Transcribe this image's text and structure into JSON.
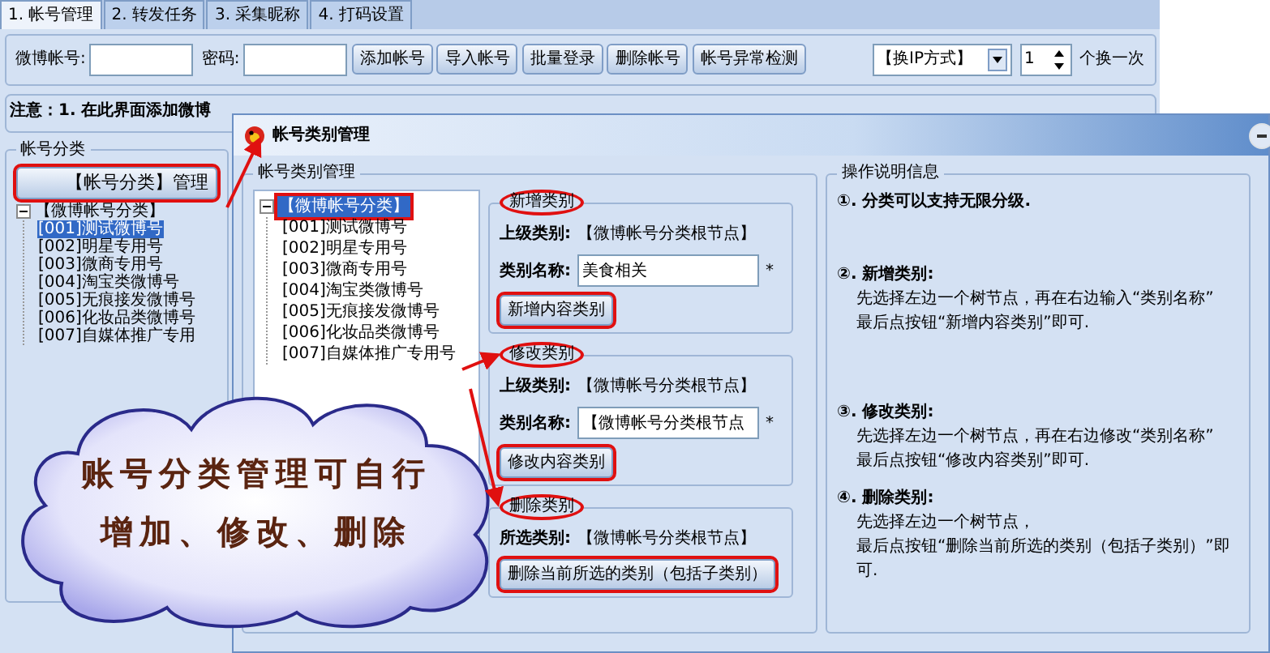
{
  "tabs": [
    {
      "label": "1. 帐号管理",
      "selected": true
    },
    {
      "label": "2. 转发任务",
      "selected": false
    },
    {
      "label": "3. 采集昵称",
      "selected": false
    },
    {
      "label": "4. 打码设置",
      "selected": false
    }
  ],
  "toolbar": {
    "account_label": "微博帐号:",
    "password_label": "密码:",
    "buttons": [
      {
        "label": "添加帐号"
      },
      {
        "label": "导入帐号"
      },
      {
        "label": "批量登录"
      },
      {
        "label": "删除帐号"
      },
      {
        "label": "帐号异常检测"
      }
    ],
    "ip_mode": {
      "value": "【换IP方式】"
    },
    "switch_count": {
      "value": "1"
    },
    "switch_suffix": "个换一次"
  },
  "notice": "注意：1. 在此界面添加微博",
  "category_panel": {
    "title": "帐号分类",
    "manage_button": {
      "label": "【帐号分类】管理",
      "highlighted": true
    },
    "tree": [
      {
        "label": "【微博帐号分类】",
        "selected": false,
        "highlighted": false,
        "expanded": true,
        "children": [
          {
            "label": "[001]测试微博号",
            "selected": true,
            "highlighted": false
          },
          {
            "label": "[002]明星专用号",
            "selected": false,
            "highlighted": false
          },
          {
            "label": "[003]微商专用号",
            "selected": false,
            "highlighted": false
          },
          {
            "label": "[004]淘宝类微博号",
            "selected": false,
            "highlighted": false
          },
          {
            "label": "[005]无痕接发微博号",
            "selected": false,
            "highlighted": false
          },
          {
            "label": "[006]化妆品类微博号",
            "selected": false,
            "highlighted": false
          },
          {
            "label": "[007]自媒体推广专用",
            "selected": false,
            "highlighted": false
          }
        ]
      }
    ]
  },
  "dialog": {
    "title": "帐号类别管理",
    "tree_group": {
      "title": "帐号类别管理",
      "tree": [
        {
          "label": "【微博帐号分类】",
          "selected": true,
          "highlighted": true,
          "expanded": true,
          "children": [
            {
              "label": "[001]测试微博号",
              "selected": false,
              "highlighted": false
            },
            {
              "label": "[002]明星专用号",
              "selected": false,
              "highlighted": false
            },
            {
              "label": "[003]微商专用号",
              "selected": false,
              "highlighted": false
            },
            {
              "label": "[004]淘宝类微博号",
              "selected": false,
              "highlighted": false
            },
            {
              "label": "[005]无痕接发微博号",
              "selected": false,
              "highlighted": false
            },
            {
              "label": "[006]化妆品类微博号",
              "selected": false,
              "highlighted": false
            },
            {
              "label": "[007]自媒体推广专用号",
              "selected": false,
              "highlighted": false
            }
          ]
        }
      ]
    },
    "add": {
      "title": "新增类别",
      "title_highlighted": true,
      "parent_label": "上级类别:",
      "parent_value": "【微博帐号分类根节点】",
      "name_label": "类别名称:",
      "name_value": "美食相关",
      "required_mark": "*",
      "button": {
        "label": "新增内容类别",
        "highlighted": true
      }
    },
    "edit": {
      "title": "修改类别",
      "title_highlighted": true,
      "parent_label": "上级类别:",
      "parent_value": "【微博帐号分类根节点】",
      "name_label": "类别名称:",
      "name_value": "【微博帐号分类根节点",
      "required_mark": "*",
      "button": {
        "label": "修改内容类别",
        "highlighted": true
      }
    },
    "delete": {
      "title": "删除类别",
      "title_highlighted": true,
      "selected_label": "所选类别:",
      "selected_value": "【微博帐号分类根节点】",
      "button": {
        "label": "删除当前所选的类别（包括子类别）",
        "highlighted": true
      }
    },
    "help": {
      "title": "操作说明信息",
      "items": [
        {
          "heading": "①. 分类可以支持无限分级."
        },
        {
          "heading": "②. 新增类别:",
          "lines": [
            "先选择左边一个树节点，再在右边输入“类别名称”",
            "最后点按钮“新增内容类别”即可."
          ]
        },
        {
          "heading": "③. 修改类别:",
          "lines": [
            "先选择左边一个树节点，再在右边修改“类别名称”",
            "最后点按钮“修改内容类别”即可."
          ]
        },
        {
          "heading": "④. 删除类别:",
          "lines": [
            "先选择左边一个树节点，",
            "最后点按钮“删除当前所选的类别（包括子类别）”即可."
          ]
        }
      ]
    }
  },
  "callout": {
    "lines": [
      "账号分类管理可自行",
      "增加、修改、删除"
    ]
  }
}
